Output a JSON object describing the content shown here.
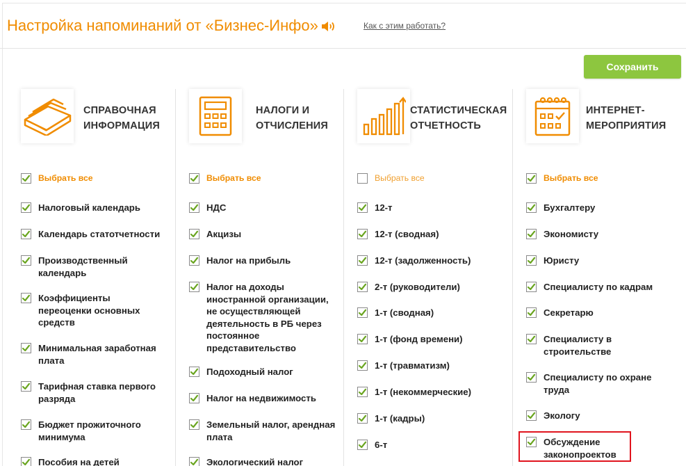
{
  "header": {
    "title": "Настройка напоминаний от «Бизнес-Инфо»",
    "sound_icon": "speaker-icon",
    "help_link": "Как с этим работать?"
  },
  "toolbar": {
    "save_label": "Сохранить"
  },
  "colors": {
    "accent": "#f08c00",
    "save_button": "#8dc63f",
    "check": "#6aa520",
    "highlight": "#e0141e"
  },
  "columns": [
    {
      "icon": "book-icon",
      "title_line1": "СПРАВОЧНАЯ",
      "title_line2": "ИНФОРМАЦИЯ",
      "select_all": {
        "label": "Выбрать все",
        "checked": true
      },
      "items": [
        {
          "label": "Налоговый календарь",
          "checked": true
        },
        {
          "label": "Календарь статотчетности",
          "checked": true
        },
        {
          "label": "Производственный календарь",
          "checked": true
        },
        {
          "label": "Коэффициенты переоценки основных средств",
          "checked": true
        },
        {
          "label": "Минимальная заработная плата",
          "checked": true
        },
        {
          "label": "Тарифная ставка первого разряда",
          "checked": true
        },
        {
          "label": "Бюджет прожиточного минимума",
          "checked": true
        },
        {
          "label": "Пособия на детей",
          "checked": true
        }
      ]
    },
    {
      "icon": "calculator-icon",
      "title_line1": "НАЛОГИ И",
      "title_line2": "ОТЧИСЛЕНИЯ",
      "select_all": {
        "label": "Выбрать все",
        "checked": true
      },
      "items": [
        {
          "label": "НДС",
          "checked": true
        },
        {
          "label": "Акцизы",
          "checked": true
        },
        {
          "label": "Налог на прибыль",
          "checked": true
        },
        {
          "label": "Налог на доходы иностранной организации, не осуществляющей деятельность в РБ через постоянное представительство",
          "checked": true
        },
        {
          "label": "Подоходный налог",
          "checked": true
        },
        {
          "label": "Налог на недвижимость",
          "checked": true
        },
        {
          "label": "Земельный налог, арендная плата",
          "checked": true
        },
        {
          "label": "Экологический налог",
          "checked": true
        }
      ]
    },
    {
      "icon": "bar-chart-icon",
      "title_line1": "СТАТИСТИЧЕСКАЯ",
      "title_line2": "ОТЧЕТНОСТЬ",
      "select_all": {
        "label": "Выбрать все",
        "checked": false
      },
      "items": [
        {
          "label": "12-т",
          "checked": true
        },
        {
          "label": "12-т (сводная)",
          "checked": true
        },
        {
          "label": "12-т (задолженность)",
          "checked": true
        },
        {
          "label": "2-т (руководители)",
          "checked": true
        },
        {
          "label": "1-т (сводная)",
          "checked": true
        },
        {
          "label": "1-т (фонд времени)",
          "checked": true
        },
        {
          "label": "1-т (травматизм)",
          "checked": true
        },
        {
          "label": "1-т (некоммерческие)",
          "checked": true
        },
        {
          "label": "1-т (кадры)",
          "checked": true
        },
        {
          "label": "6-т",
          "checked": true
        }
      ]
    },
    {
      "icon": "calendar-icon",
      "title_line1": "ИНТЕРНЕТ-",
      "title_line2": "МЕРОПРИЯТИЯ",
      "select_all": {
        "label": "Выбрать все",
        "checked": true
      },
      "items": [
        {
          "label": "Бухгалтеру",
          "checked": true
        },
        {
          "label": "Экономисту",
          "checked": true
        },
        {
          "label": "Юристу",
          "checked": true
        },
        {
          "label": "Специалисту по кадрам",
          "checked": true
        },
        {
          "label": "Секретарю",
          "checked": true
        },
        {
          "label": "Специалисту в строительстве",
          "checked": true
        },
        {
          "label": "Специалисту по охране труда",
          "checked": true
        },
        {
          "label": "Экологу",
          "checked": true
        },
        {
          "label": "Обсуждение законопроектов",
          "checked": true
        }
      ]
    }
  ]
}
